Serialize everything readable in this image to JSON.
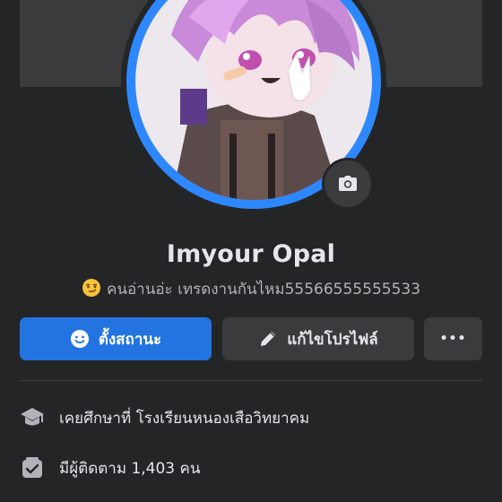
{
  "profile": {
    "name": "Imyour Opal",
    "bio_emoji": "smirk-emoji",
    "bio_text": "คนอ่านอ่ะ เทรดงานกันไหม55566555555533"
  },
  "actions": {
    "add_story_label": "ตั้งสถานะ",
    "edit_profile_label": "แก้ไขโปรไฟล์",
    "more_label": "•••"
  },
  "details": {
    "education": "เคยศึกษาที่ โรงเรียนหนองเสือวิทยาคม",
    "followers": "มีผู้ติดตาม 1,403 คน"
  },
  "icons": {
    "camera": "camera-icon",
    "smile": "smile-icon",
    "pencil": "pencil-icon",
    "education": "graduation-cap-icon",
    "followers": "followers-icon"
  },
  "colors": {
    "background": "#242526",
    "accent": "#2374e1",
    "ring": "#2d88ff",
    "button_secondary": "#3a3b3c"
  }
}
